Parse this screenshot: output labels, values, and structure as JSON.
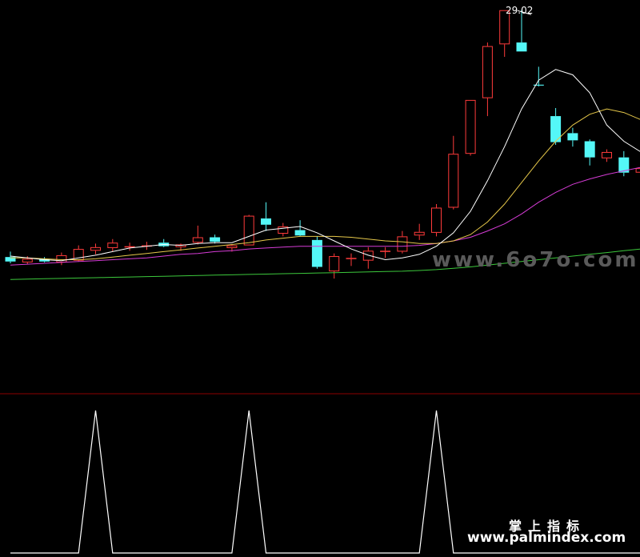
{
  "watermarks": {
    "site_gray": "www.6o7o.com",
    "brand_cn": "掌上指标",
    "site_white": "www.palmindex.com"
  },
  "colors": {
    "background": "#000000",
    "up_candle": "#ff3b3b",
    "down_candle": "#54f7f7",
    "ma5": "#ffffff",
    "ma10": "#e6c84a",
    "ma20": "#d63cd6",
    "ma60": "#3cc83c",
    "divider": "#8b0000",
    "signal": "#ffffff"
  },
  "chart_data": {
    "type": "candlestick",
    "peak_label": "29.02",
    "candles": [
      {
        "o": 15.25,
        "h": 15.55,
        "l": 14.9,
        "c": 15.0
      },
      {
        "o": 14.95,
        "h": 15.3,
        "l": 14.85,
        "c": 15.15
      },
      {
        "o": 15.15,
        "h": 15.25,
        "l": 14.95,
        "c": 15.0
      },
      {
        "o": 14.95,
        "h": 15.5,
        "l": 14.8,
        "c": 15.35
      },
      {
        "o": 15.05,
        "h": 15.9,
        "l": 15.0,
        "c": 15.7
      },
      {
        "o": 15.6,
        "h": 16.0,
        "l": 15.4,
        "c": 15.8
      },
      {
        "o": 15.75,
        "h": 16.25,
        "l": 15.55,
        "c": 16.05
      },
      {
        "o": 15.8,
        "h": 16.05,
        "l": 15.6,
        "c": 15.85
      },
      {
        "o": 15.9,
        "h": 16.1,
        "l": 15.65,
        "c": 15.9
      },
      {
        "o": 16.05,
        "h": 16.25,
        "l": 15.8,
        "c": 15.85
      },
      {
        "o": 15.8,
        "h": 16.0,
        "l": 15.6,
        "c": 15.95
      },
      {
        "o": 16.05,
        "h": 17.0,
        "l": 15.95,
        "c": 16.35
      },
      {
        "o": 16.35,
        "h": 16.5,
        "l": 16.0,
        "c": 16.1
      },
      {
        "o": 15.75,
        "h": 15.95,
        "l": 15.55,
        "c": 15.9
      },
      {
        "o": 15.9,
        "h": 17.6,
        "l": 15.9,
        "c": 17.55
      },
      {
        "o": 17.4,
        "h": 18.3,
        "l": 16.7,
        "c": 17.05
      },
      {
        "o": 16.55,
        "h": 17.15,
        "l": 16.4,
        "c": 16.95
      },
      {
        "o": 16.75,
        "h": 17.3,
        "l": 16.4,
        "c": 16.45
      },
      {
        "o": 16.2,
        "h": 16.4,
        "l": 14.6,
        "c": 14.7
      },
      {
        "o": 14.45,
        "h": 15.45,
        "l": 14.05,
        "c": 15.3
      },
      {
        "o": 15.2,
        "h": 15.45,
        "l": 14.75,
        "c": 15.2
      },
      {
        "o": 15.05,
        "h": 15.8,
        "l": 14.6,
        "c": 15.6
      },
      {
        "o": 15.6,
        "h": 15.8,
        "l": 15.2,
        "c": 15.6
      },
      {
        "o": 15.55,
        "h": 16.7,
        "l": 15.45,
        "c": 16.4
      },
      {
        "o": 16.45,
        "h": 17.1,
        "l": 16.2,
        "c": 16.65
      },
      {
        "o": 16.6,
        "h": 18.2,
        "l": 16.4,
        "c": 18.0
      },
      {
        "o": 18.0,
        "h": 22.0,
        "l": 17.9,
        "c": 21.0
      },
      {
        "o": 21.0,
        "h": 24.0,
        "l": 20.9,
        "c": 24.0
      },
      {
        "o": 24.1,
        "h": 27.2,
        "l": 23.1,
        "c": 27.0
      },
      {
        "o": 27.1,
        "h": 29.0,
        "l": 26.4,
        "c": 29.0
      },
      {
        "o": 27.2,
        "h": 29.02,
        "l": 26.7,
        "c": 26.7
      },
      {
        "o": 24.85,
        "h": 25.85,
        "l": 24.75,
        "c": 24.8
      },
      {
        "o": 23.1,
        "h": 23.55,
        "l": 21.5,
        "c": 21.65
      },
      {
        "o": 22.15,
        "h": 22.45,
        "l": 21.4,
        "c": 21.75
      },
      {
        "o": 21.7,
        "h": 21.8,
        "l": 20.35,
        "c": 20.8
      },
      {
        "o": 20.75,
        "h": 21.25,
        "l": 20.55,
        "c": 21.1
      },
      {
        "o": 20.8,
        "h": 21.15,
        "l": 19.75,
        "c": 19.95
      },
      {
        "o": 19.95,
        "h": 20.4,
        "l": 19.65,
        "c": 20.2
      }
    ],
    "ma5": [
      15.3,
      15.2,
      15.1,
      15.05,
      15.2,
      15.35,
      15.55,
      15.75,
      15.85,
      15.95,
      15.9,
      16.0,
      16.05,
      16.05,
      16.4,
      16.75,
      16.85,
      16.95,
      16.6,
      16.15,
      15.7,
      15.35,
      15.1,
      15.2,
      15.4,
      15.85,
      16.6,
      17.8,
      19.5,
      21.4,
      23.5,
      25.1,
      25.7,
      25.4,
      24.4,
      22.6,
      21.7,
      21.1,
      20.8
    ],
    "ma10": [
      15.2,
      15.2,
      15.15,
      15.1,
      15.1,
      15.15,
      15.25,
      15.35,
      15.45,
      15.55,
      15.65,
      15.75,
      15.85,
      15.95,
      16.05,
      16.2,
      16.3,
      16.4,
      16.4,
      16.4,
      16.35,
      16.25,
      16.15,
      16.1,
      16.0,
      16.0,
      16.15,
      16.5,
      17.2,
      18.2,
      19.4,
      20.6,
      21.7,
      22.6,
      23.2,
      23.5,
      23.3,
      22.9,
      22.2
    ],
    "ma20": [
      14.8,
      14.85,
      14.9,
      14.95,
      15.0,
      15.05,
      15.1,
      15.15,
      15.2,
      15.3,
      15.4,
      15.45,
      15.55,
      15.6,
      15.7,
      15.75,
      15.8,
      15.85,
      15.85,
      15.85,
      15.85,
      15.85,
      15.85,
      15.85,
      15.9,
      16.0,
      16.15,
      16.35,
      16.7,
      17.1,
      17.65,
      18.3,
      18.85,
      19.3,
      19.6,
      19.85,
      20.05,
      20.25,
      20.4
    ],
    "ma60": [
      14.0,
      14.02,
      14.04,
      14.06,
      14.08,
      14.1,
      14.12,
      14.14,
      14.16,
      14.18,
      14.2,
      14.22,
      14.24,
      14.26,
      14.28,
      14.3,
      14.32,
      14.34,
      14.36,
      14.38,
      14.4,
      14.42,
      14.44,
      14.46,
      14.5,
      14.55,
      14.62,
      14.7,
      14.8,
      14.9,
      15.0,
      15.1,
      15.2,
      15.3,
      15.4,
      15.5,
      15.6,
      15.7,
      15.8
    ],
    "signal": [
      0,
      0,
      0,
      0,
      0,
      1,
      0,
      0,
      0,
      0,
      0,
      0,
      0,
      0,
      1,
      0,
      0,
      0,
      0,
      0,
      0,
      0,
      0,
      0,
      0,
      1,
      0,
      0,
      0,
      0,
      0,
      0,
      0,
      0,
      0,
      0,
      0,
      0
    ]
  }
}
